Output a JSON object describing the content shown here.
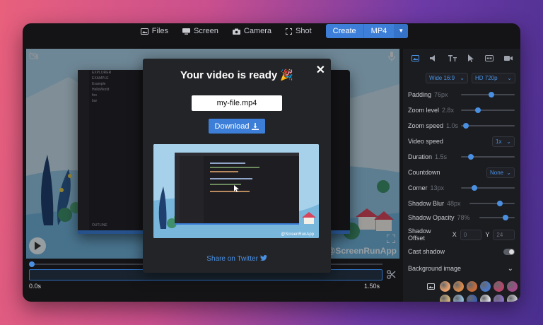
{
  "toolbar": {
    "items": [
      {
        "label": "Files",
        "icon": "image-icon"
      },
      {
        "label": "Screen",
        "icon": "monitor-icon"
      },
      {
        "label": "Camera",
        "icon": "camera-icon"
      },
      {
        "label": "Shot",
        "icon": "crop-icon"
      }
    ],
    "create_label": "Create",
    "format_label": "MP4"
  },
  "stage": {
    "watermark": "@ScreenRunApp",
    "editor_tree": [
      "EXPLORER",
      "EXAMPLE",
      "Example",
      "HelloWorld",
      "foo",
      "bar",
      "OUTLINE"
    ]
  },
  "timeline": {
    "start_time": "0.0s",
    "end_time": "1.50s",
    "playhead_fraction": 0
  },
  "modal": {
    "title": "Your video is ready 🎉",
    "filename": "my-file.mp4",
    "download_label": "Download",
    "share_label": "Share on Twitter",
    "preview_watermark": "@ScreenRunApp"
  },
  "panel": {
    "aspect_select": "Wide 16:9",
    "resolution_select": "HD 720p",
    "settings": [
      {
        "label": "Padding",
        "value": "76px",
        "level": 0.58
      },
      {
        "label": "Zoom level",
        "value": "2.8x",
        "level": 0.3
      },
      {
        "label": "Zoom speed",
        "value": "1.0s",
        "level": 0.05
      },
      {
        "label": "Video speed",
        "select": "1x"
      },
      {
        "label": "Duration",
        "value": "1.5s",
        "level": 0.15
      },
      {
        "label": "Countdown",
        "select": "None"
      },
      {
        "label": "Corner",
        "value": "13px",
        "level": 0.22
      },
      {
        "label": "Shadow Blur",
        "value": "48px",
        "level": 0.7
      },
      {
        "label": "Shadow Opacity",
        "value": "78%",
        "level": 0.78
      }
    ],
    "shadow_offset": {
      "label": "Shadow Offset",
      "x_label": "X",
      "x": "0",
      "y_label": "Y",
      "y": "24"
    },
    "cast_shadow": {
      "label": "Cast shadow",
      "on": false
    },
    "background_image": {
      "label": "Background image"
    },
    "swatch_colors": [
      "#e8a06b",
      "#d98a4a",
      "#c86b3a",
      "#4a78c9",
      "#b8456a",
      "#a64a8a",
      "#d2b47a",
      "#8fb8d8",
      "#3c5fb0",
      "#e0e0e8",
      "#8a6fc7",
      "#c7c9cf"
    ]
  },
  "colors": {
    "accent": "#3d7fd8",
    "panel_bg": "#1b1c20",
    "window_bg": "#141417"
  }
}
